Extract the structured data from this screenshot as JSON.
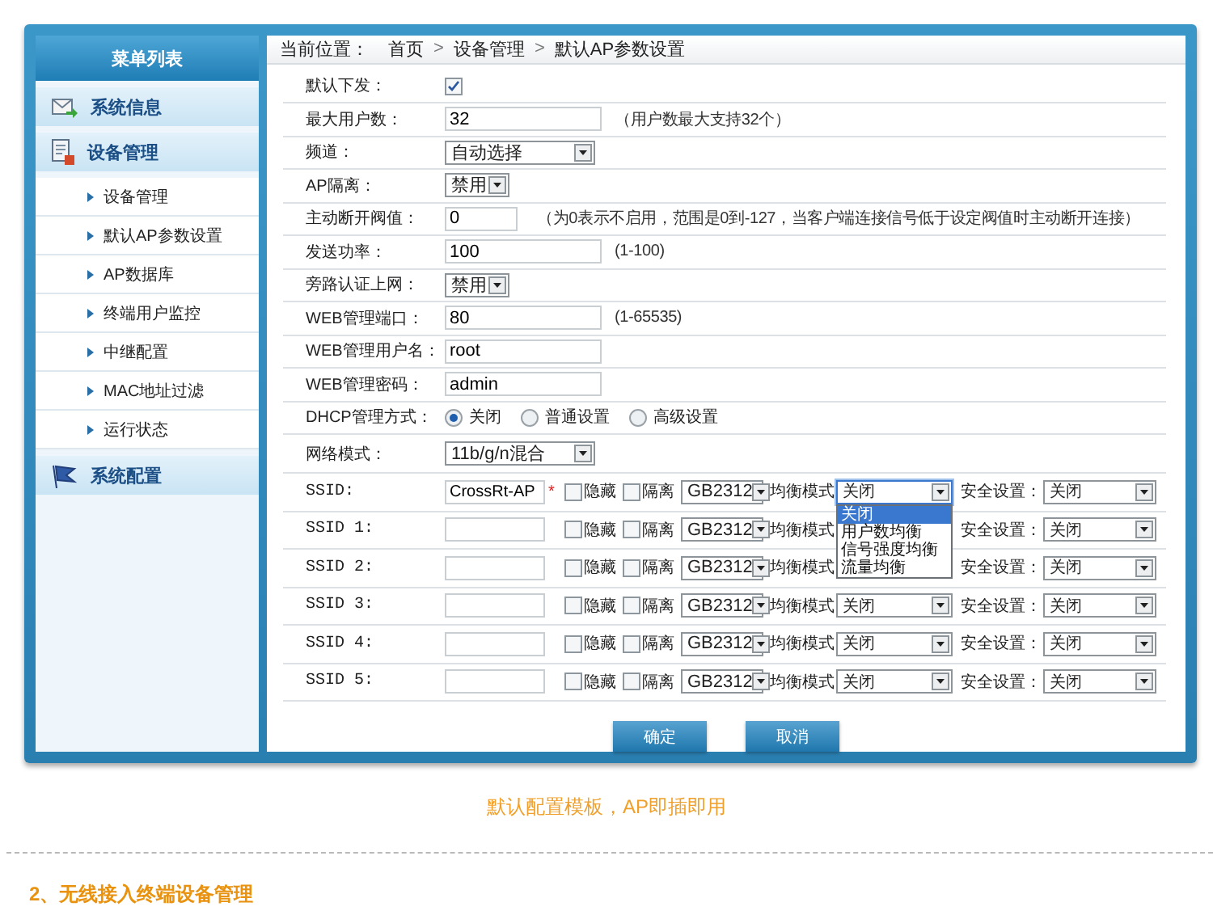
{
  "sidebar": {
    "title": "菜单列表",
    "sections": [
      {
        "label": "系统信息"
      },
      {
        "label": "设备管理",
        "expanded": true,
        "children": [
          {
            "label": "设备管理"
          },
          {
            "label": "默认AP参数设置"
          },
          {
            "label": "AP数据库"
          },
          {
            "label": "终端用户监控"
          },
          {
            "label": "中继配置"
          },
          {
            "label": "MAC地址过滤"
          },
          {
            "label": "运行状态"
          }
        ]
      },
      {
        "label": "系统配置"
      }
    ]
  },
  "breadcrumb": {
    "label": "当前位置：",
    "separator": ">",
    "items": [
      "首页",
      "设备管理",
      "默认AP参数设置"
    ]
  },
  "form": {
    "rows": [
      {
        "kind": "checkbox",
        "label": "默认下发：",
        "checked": true
      },
      {
        "kind": "text",
        "label": "最大用户数：",
        "value": "32",
        "hint": "（用户数最大支持32个）"
      },
      {
        "kind": "select",
        "label": "频道：",
        "value": "自动选择"
      },
      {
        "kind": "short-select",
        "label": "AP隔离：",
        "value": "禁用"
      },
      {
        "kind": "short-text",
        "label": "主动断开阀值：",
        "value": "0",
        "hint": "（为0表示不启用，范围是0到-127，当客户端连接信号低于设定阀值时主动断开连接）"
      },
      {
        "kind": "text",
        "label": "发送功率：",
        "value": "100",
        "hint": "(1-100)"
      },
      {
        "kind": "short-select",
        "label": "旁路认证上网：",
        "value": "禁用"
      },
      {
        "kind": "text",
        "label": "WEB管理端口：",
        "value": "80",
        "hint": "(1-65535)"
      },
      {
        "kind": "text",
        "label": "WEB管理用户名：",
        "value": "root"
      },
      {
        "kind": "text",
        "label": "WEB管理密码：",
        "value": "admin"
      },
      {
        "kind": "radio",
        "label": "DHCP管理方式：",
        "options": [
          {
            "label": "关闭",
            "selected": true
          },
          {
            "label": "普通设置",
            "selected": false
          },
          {
            "label": "高级设置",
            "selected": false
          }
        ]
      },
      {
        "kind": "select",
        "label": "网络模式：",
        "value": "11b/g/n混合"
      }
    ]
  },
  "ssids": [
    {
      "label": "SSID:",
      "value": "CrossRt-AP",
      "required_mark": "*",
      "hidden": {
        "label": "隐藏",
        "checked": false
      },
      "isolated": {
        "label": "隔离",
        "checked": false
      },
      "charset": "GB2312",
      "mode_label": "均衡模式",
      "mode": "关闭",
      "mode_menu": {
        "expanded": true,
        "options": [
          {
            "label": "关闭",
            "selected": true
          },
          {
            "label": "用户数均衡",
            "selected": false
          },
          {
            "label": "信号强度均衡",
            "selected": false
          },
          {
            "label": "流量均衡",
            "selected": false
          }
        ]
      },
      "security_label": "安全设置：",
      "security": "关闭"
    },
    {
      "label": "SSID 1:",
      "hidden": {
        "label": "隐藏",
        "checked": false
      },
      "isolated": {
        "label": "隔离",
        "checked": false
      },
      "charset": "GB2312",
      "mode_label": "均衡模式",
      "security_label": "安全设置：",
      "security": "关闭"
    },
    {
      "label": "SSID 2:",
      "hidden": {
        "label": "隐藏",
        "checked": false
      },
      "isolated": {
        "label": "隔离",
        "checked": false
      },
      "charset": "GB2312",
      "mode_label": "均衡模式",
      "security_label": "安全设置：",
      "security": "关闭"
    },
    {
      "label": "SSID 3:",
      "hidden": {
        "label": "隐藏",
        "checked": false
      },
      "isolated": {
        "label": "隔离",
        "checked": false
      },
      "charset": "GB2312",
      "mode_label": "均衡模式",
      "mode": "关闭",
      "security_label": "安全设置：",
      "security": "关闭"
    },
    {
      "label": "SSID 4:",
      "hidden": {
        "label": "隐藏",
        "checked": false
      },
      "isolated": {
        "label": "隔离",
        "checked": false
      },
      "charset": "GB2312",
      "mode_label": "均衡模式",
      "mode": "关闭",
      "security_label": "安全设置：",
      "security": "关闭"
    },
    {
      "label": "SSID 5:",
      "hidden": {
        "label": "隐藏",
        "checked": false
      },
      "isolated": {
        "label": "隔离",
        "checked": false
      },
      "charset": "GB2312",
      "mode_label": "均衡模式",
      "mode": "关闭",
      "security_label": "安全设置：",
      "security": "关闭"
    }
  ],
  "buttons": [
    "确定",
    "取消"
  ],
  "caption": "默认配置模板，AP即插即用",
  "section_heading": "2、无线接入终端设备管理"
}
